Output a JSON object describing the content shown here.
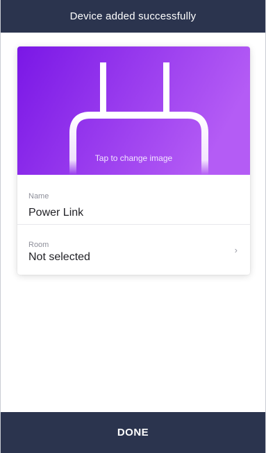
{
  "header": {
    "title": "Device added successfully"
  },
  "device_card": {
    "image_hint": "Tap to change image",
    "image_icon": "power-plug-icon",
    "colors": {
      "gradient_start": "#7a17e6",
      "gradient_end": "#b45cf5"
    },
    "name_field": {
      "label": "Name",
      "value": "Power Link"
    },
    "room_field": {
      "label": "Room",
      "value": "Not selected",
      "icon": "chevron-right-icon"
    }
  },
  "footer": {
    "done_label": "DONE"
  },
  "colors": {
    "bar_background": "#2b344e"
  }
}
